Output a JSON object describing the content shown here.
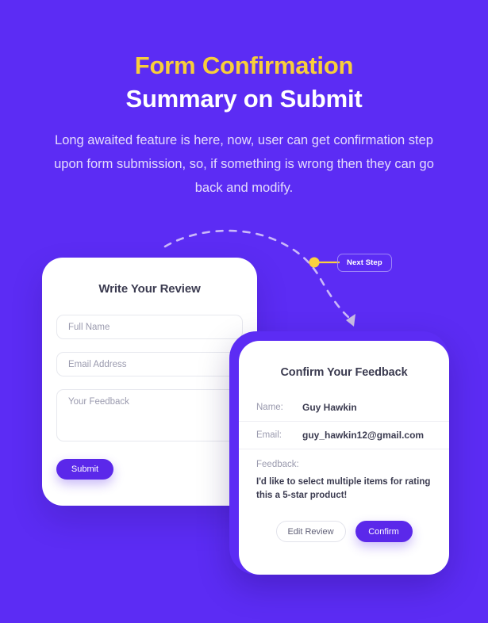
{
  "hero": {
    "title_line1": "Form Confirmation",
    "title_line2": "Summary on Submit",
    "subtitle": "Long awaited feature is here, now, user can get confirmation step upon form submission, so, if something is wrong then they can go back and modify.",
    "title_accent_color": "#F8CE3A",
    "background_color": "#5C2CF4"
  },
  "annotation": {
    "badge_label": "Next Step",
    "dot_color": "#FBD13E",
    "dash_color": "#CBB8FA"
  },
  "review_form": {
    "title": "Write Your Review",
    "fields": [
      {
        "placeholder": "Full Name"
      },
      {
        "placeholder": "Email Address"
      },
      {
        "placeholder": "Your Feedback"
      }
    ],
    "submit_label": "Submit",
    "accent_color": "#5B28EA"
  },
  "confirmation": {
    "title": "Confirm Your Feedback",
    "rows": [
      {
        "label": "Name:",
        "value": "Guy Hawkin"
      },
      {
        "label": "Email:",
        "value": "guy_hawkin12@gmail.com"
      }
    ],
    "feedback_label": "Feedback:",
    "feedback_value": "I'd like to select multiple items for rating this a 5-star product!",
    "edit_label": "Edit Review",
    "confirm_label": "Confirm",
    "accent_color": "#5B28EA"
  }
}
